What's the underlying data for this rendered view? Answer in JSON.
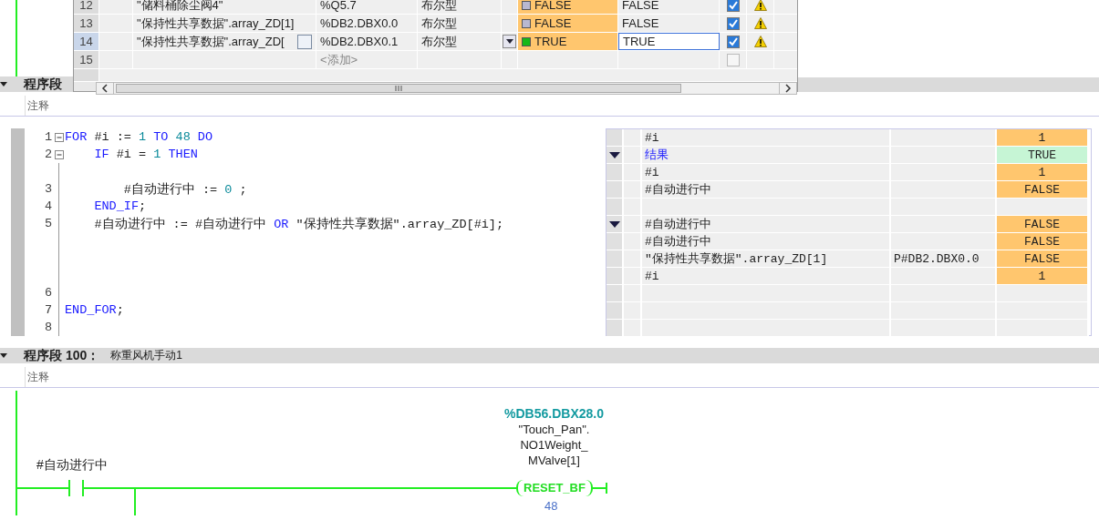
{
  "var_table": {
    "rows": [
      {
        "kind": "var",
        "number": "12",
        "name": "\"储料桶除尘阀4\"",
        "address": "%Q5.7",
        "type": "布尔型",
        "monitor": "FALSE",
        "on": false,
        "modify": "FALSE",
        "checked": true,
        "warning": true,
        "selected": false
      },
      {
        "kind": "var",
        "number": "13",
        "name": "\"保持性共享数据\".array_ZD[1]",
        "address": "%DB2.DBX0.0",
        "type": "布尔型",
        "monitor": "FALSE",
        "on": false,
        "modify": "FALSE",
        "checked": true,
        "warning": true,
        "selected": false
      },
      {
        "kind": "var",
        "number": "14",
        "name": "\"保持性共享数据\".array_ZD[",
        "address": "%DB2.DBX0.1",
        "type": "布尔型",
        "monitor": "TRUE",
        "on": true,
        "modify": "TRUE",
        "checked": true,
        "warning": true,
        "selected": true
      },
      {
        "kind": "add",
        "number": "15",
        "address": "<添加>",
        "checked": false,
        "warning": false,
        "selected": false
      }
    ]
  },
  "network_1": {
    "title": "程序段",
    "comment": "注释",
    "code": [
      {
        "kind": "line",
        "number": "1",
        "foldable": true,
        "tokens": [
          {
            "kind": "keyword",
            "text": "FOR"
          },
          {
            "kind": "plain",
            "text": " #i := "
          },
          {
            "kind": "number",
            "text": "1"
          },
          {
            "kind": "keyword",
            "text": " TO "
          },
          {
            "kind": "number",
            "text": "48"
          },
          {
            "kind": "keyword",
            "text": " DO"
          }
        ]
      },
      {
        "kind": "line",
        "number": "2",
        "foldable": true,
        "tokens": [
          {
            "kind": "keyword",
            "text": "    IF"
          },
          {
            "kind": "plain",
            "text": " #i = "
          },
          {
            "kind": "number",
            "text": "1"
          },
          {
            "kind": "keyword",
            "text": " THEN"
          }
        ]
      },
      {
        "kind": "spacer"
      },
      {
        "kind": "line",
        "number": "3",
        "foldable": false,
        "tokens": [
          {
            "kind": "plain",
            "text": "        #自动进行中 := "
          },
          {
            "kind": "number",
            "text": "0"
          },
          {
            "kind": "plain",
            "text": " ;"
          }
        ]
      },
      {
        "kind": "line",
        "number": "4",
        "foldable": false,
        "tokens": [
          {
            "kind": "keyword",
            "text": "    END_IF"
          },
          {
            "kind": "plain",
            "text": ";"
          }
        ]
      },
      {
        "kind": "line",
        "number": "5",
        "foldable": false,
        "tokens": [
          {
            "kind": "plain",
            "text": "    #自动进行中 := #自动进行中 "
          },
          {
            "kind": "keyword",
            "text": "OR"
          },
          {
            "kind": "plain",
            "text": " \"保持性共享数据\".array_ZD[#i];"
          }
        ]
      },
      {
        "kind": "spacer"
      },
      {
        "kind": "spacer"
      },
      {
        "kind": "spacer"
      },
      {
        "kind": "line",
        "number": "6",
        "foldable": false
      },
      {
        "kind": "line",
        "number": "7",
        "foldable": false,
        "tokens": [
          {
            "kind": "keyword",
            "text": "END_FOR"
          },
          {
            "kind": "plain",
            "text": ";"
          }
        ]
      },
      {
        "kind": "line",
        "number": "8",
        "foldable": false
      }
    ],
    "watch": [
      {
        "kind": "variable",
        "marker": false,
        "name": "#i",
        "value": "1",
        "color": "#ffc66e"
      },
      {
        "kind": "result",
        "marker": true,
        "name": "结果",
        "value": "TRUE",
        "color": "#c6f5d5"
      },
      {
        "kind": "variable",
        "marker": false,
        "name": "#i",
        "value": "1",
        "color": "#ffc66e"
      },
      {
        "kind": "variable",
        "marker": false,
        "name": "#自动进行中",
        "value": "FALSE",
        "color": "#ffc66e"
      },
      {
        "kind": "empty",
        "marker": false
      },
      {
        "kind": "variable",
        "marker": true,
        "name": "#自动进行中",
        "value": "FALSE",
        "color": "#ffc66e"
      },
      {
        "kind": "variable",
        "marker": false,
        "name": "#自动进行中",
        "value": "FALSE",
        "color": "#ffc66e"
      },
      {
        "kind": "variable",
        "marker": false,
        "name": "\"保持性共享数据\".array_ZD[1]",
        "address": "P#DB2.DBX0.0",
        "value": "FALSE",
        "color": "#ffc66e"
      },
      {
        "kind": "variable",
        "marker": false,
        "name": "#i",
        "value": "1",
        "color": "#ffc66e"
      },
      {
        "kind": "empty",
        "marker": false
      },
      {
        "kind": "empty",
        "marker": false
      },
      {
        "kind": "empty",
        "marker": false
      }
    ]
  },
  "network_100": {
    "title": "程序段 100：",
    "name": "称重风机手动1",
    "comment": "注释",
    "contact": {
      "operand": "#自动进行中"
    },
    "coil": {
      "address": "%DB56.DBX28.0",
      "operand": [
        "\"Touch_Pan\".",
        "NO1Weight_",
        "MValve[1]"
      ],
      "label": "RESET_BF",
      "index": "48"
    }
  }
}
